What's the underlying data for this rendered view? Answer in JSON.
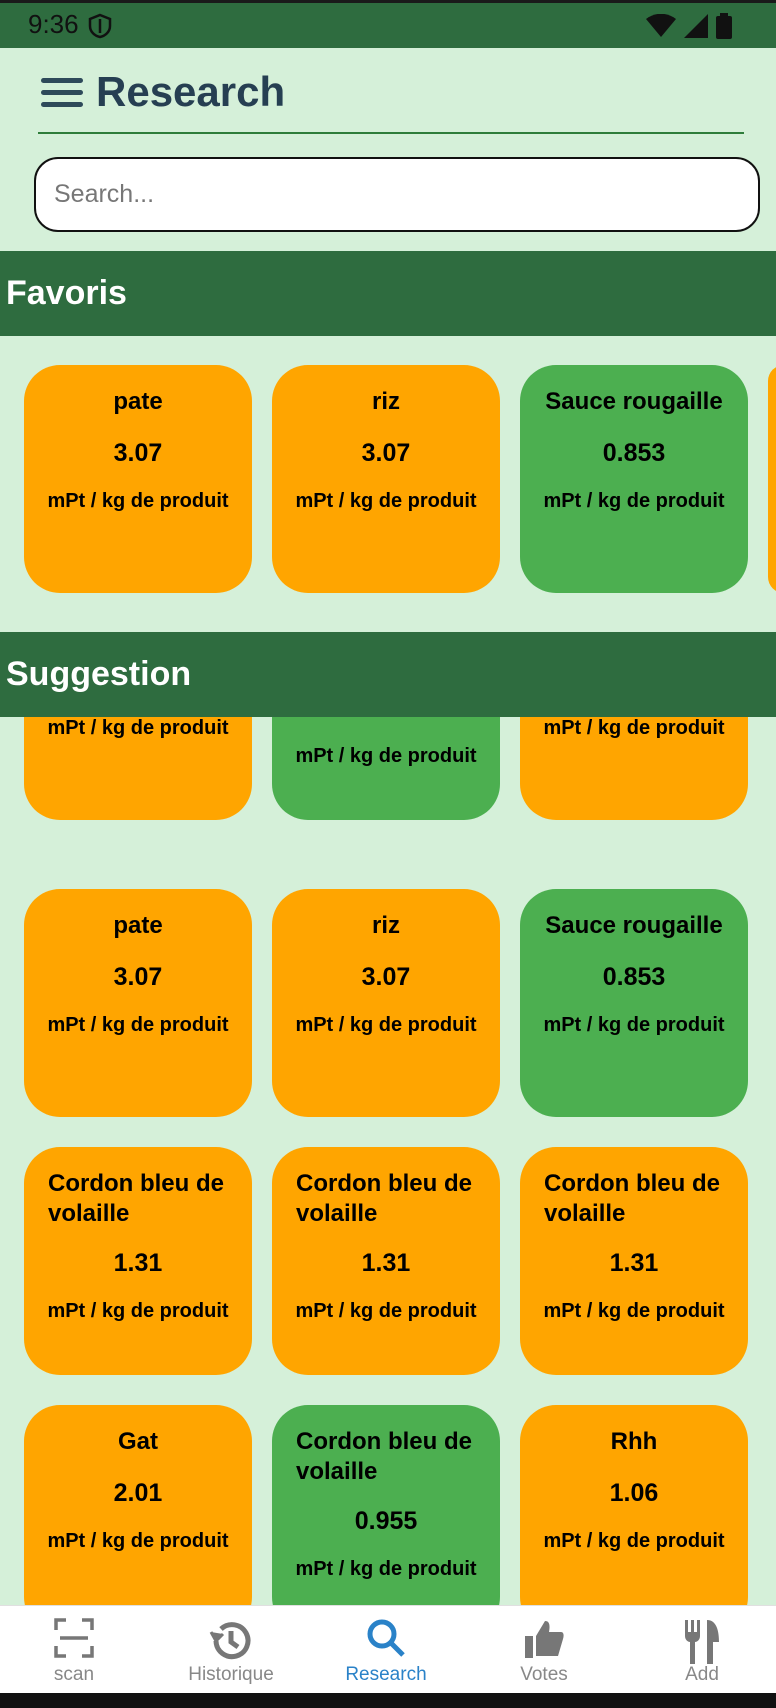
{
  "status_bar": {
    "time": "9:36"
  },
  "header": {
    "title": "Research"
  },
  "search": {
    "placeholder": "Search..."
  },
  "sections": {
    "favoris": "Favoris",
    "suggestion": "Suggestion"
  },
  "favorites": [
    {
      "name": "pate",
      "score": "3.07",
      "unit": "mPt / kg de produit",
      "color": "#ffa500"
    },
    {
      "name": "riz",
      "score": "3.07",
      "unit": "mPt / kg de produit",
      "color": "#ffa500"
    },
    {
      "name": "Sauce rougaille",
      "score": "0.853",
      "unit": "mPt / kg de produit",
      "color": "#4caf50"
    }
  ],
  "suggestions": [
    {
      "name": "Gat",
      "score": "2.01",
      "unit": "mPt / kg de produit",
      "color": "#ffa500"
    },
    {
      "name": "Cordon bleu de volaille",
      "score": "0.955",
      "unit": "mPt / kg de produit",
      "color": "#4caf50"
    },
    {
      "name": "Rhh",
      "score": "1.06",
      "unit": "mPt / kg de produit",
      "color": "#ffa500"
    },
    {
      "name": "pate",
      "score": "3.07",
      "unit": "mPt / kg de produit",
      "color": "#ffa500"
    },
    {
      "name": "riz",
      "score": "3.07",
      "unit": "mPt / kg de produit",
      "color": "#ffa500"
    },
    {
      "name": "Sauce rougaille",
      "score": "0.853",
      "unit": "mPt / kg de produit",
      "color": "#4caf50"
    },
    {
      "name": "Cordon bleu de volaille",
      "score": "1.31",
      "unit": "mPt / kg de produit",
      "color": "#ffa500"
    },
    {
      "name": "Cordon bleu de volaille",
      "score": "1.31",
      "unit": "mPt / kg de produit",
      "color": "#ffa500"
    },
    {
      "name": "Cordon bleu de volaille",
      "score": "1.31",
      "unit": "mPt / kg de produit",
      "color": "#ffa500"
    },
    {
      "name": "Gat",
      "score": "2.01",
      "unit": "mPt / kg de produit",
      "color": "#ffa500"
    },
    {
      "name": "Cordon bleu de volaille",
      "score": "0.955",
      "unit": "mPt / kg de produit",
      "color": "#4caf50"
    },
    {
      "name": "Rhh",
      "score": "1.06",
      "unit": "mPt / kg de produit",
      "color": "#ffa500"
    }
  ],
  "nav": {
    "items": [
      {
        "label": "scan",
        "icon": "scan-icon"
      },
      {
        "label": "Historique",
        "icon": "history-icon"
      },
      {
        "label": "Research",
        "icon": "search-icon"
      },
      {
        "label": "Votes",
        "icon": "thumb-up-icon"
      },
      {
        "label": "Add",
        "icon": "fork-knife-icon"
      }
    ],
    "active": "Research",
    "active_color": "#2a82c8"
  },
  "colors": {
    "primary": "#2e6c3f",
    "background": "#d5f0d9",
    "orange": "#ffa500",
    "green": "#4caf50"
  }
}
